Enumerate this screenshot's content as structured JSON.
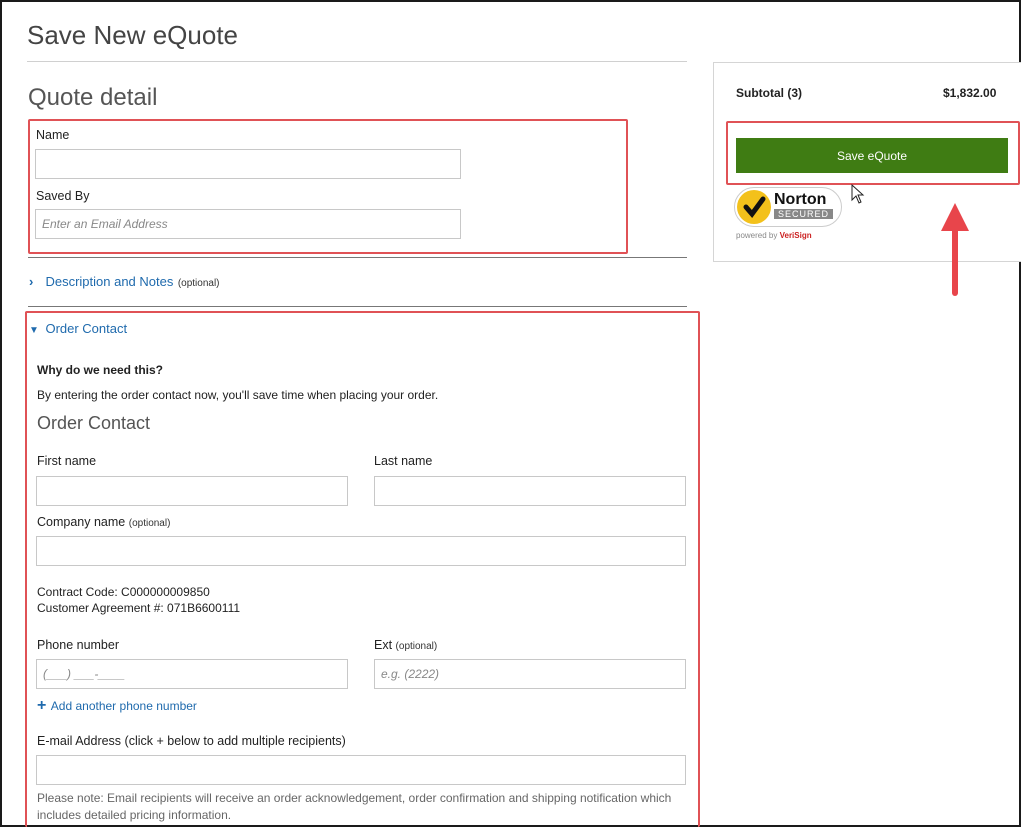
{
  "header": {
    "title": "Save New eQuote"
  },
  "quote_detail": {
    "heading": "Quote detail",
    "name_label": "Name",
    "name_value": "",
    "saved_by_label": "Saved By",
    "saved_by_placeholder": "Enter an Email Address"
  },
  "description": {
    "label": "Description and Notes",
    "optional": "(optional)"
  },
  "order_contact": {
    "toggle_label": "Order Contact",
    "why_heading": "Why do we need this?",
    "why_text": "By entering the order contact now, you'll save time when placing your order.",
    "subheading": "Order Contact",
    "first_name_label": "First name",
    "last_name_label": "Last name",
    "company_label": "Company name",
    "company_optional": "(optional)",
    "contract_code": "Contract Code: C000000009850",
    "customer_agreement": "Customer Agreement #: 071B6600111",
    "phone_label": "Phone number",
    "phone_placeholder": "(___) ___-____",
    "ext_label": "Ext",
    "ext_optional": "(optional)",
    "ext_placeholder": "e.g. (2222)",
    "add_phone": "Add another phone number",
    "email_label": "E-mail Address (click + below to add multiple recipients)",
    "email_note": "Please note: Email recipients will receive an order acknowledgement, order confirmation and shipping notification which includes detailed pricing information."
  },
  "summary": {
    "subtotal_label": "Subtotal (3)",
    "subtotal_value": "$1,832.00",
    "save_button": "Save eQuote",
    "norton_main": "Norton",
    "norton_secured": "SECURED",
    "norton_powered": "powered by",
    "norton_verisign": "VeriSign"
  },
  "colors": {
    "highlight": "#e05256",
    "accent_green": "#3f7c13",
    "link_blue": "#1f6aad"
  },
  "icons": [
    "chevron-right-icon",
    "chevron-down-icon",
    "plus-icon",
    "norton-checkmark-icon",
    "mouse-cursor-icon",
    "annotation-arrow-icon"
  ]
}
